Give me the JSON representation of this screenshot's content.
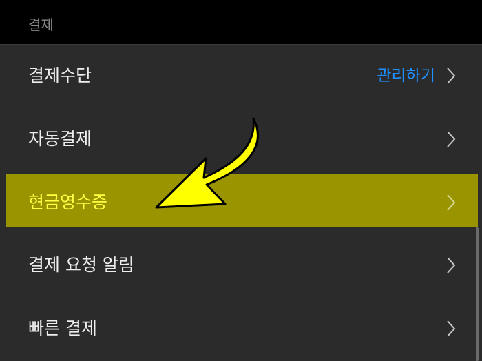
{
  "section": {
    "title": "결제"
  },
  "items": [
    {
      "label": "결제수단",
      "action": "관리하기"
    },
    {
      "label": "자동결제"
    },
    {
      "label": "현금영수증"
    },
    {
      "label": "결제 요청 알림"
    },
    {
      "label": "빠른 결제"
    }
  ],
  "colors": {
    "background": "#2b2b2b",
    "header_background": "#000000",
    "action_link": "#1e90ff",
    "highlight": "#999400",
    "highlight_text": "#ffff44",
    "arrow_fill": "#ffff00",
    "arrow_stroke": "#000000"
  },
  "icons": {
    "chevron": "chevron-right-icon",
    "annotation": "annotation-arrow"
  }
}
